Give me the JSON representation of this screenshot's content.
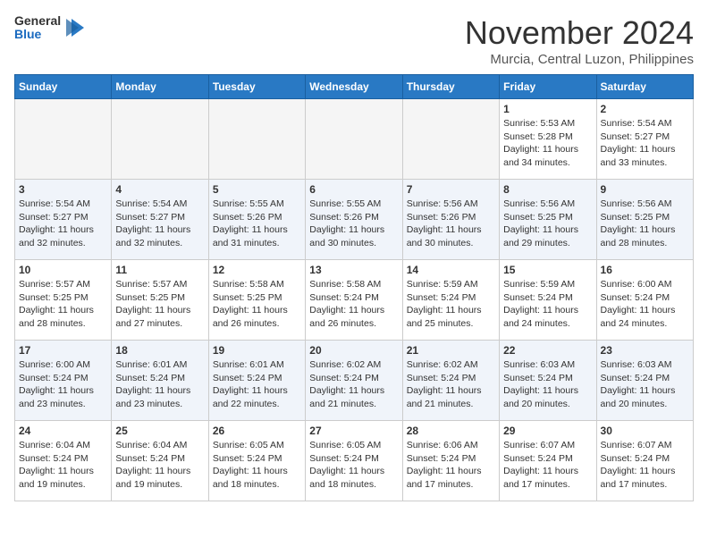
{
  "logo": {
    "general": "General",
    "blue": "Blue"
  },
  "title": "November 2024",
  "location": "Murcia, Central Luzon, Philippines",
  "days_header": [
    "Sunday",
    "Monday",
    "Tuesday",
    "Wednesday",
    "Thursday",
    "Friday",
    "Saturday"
  ],
  "weeks": [
    [
      {
        "day": "",
        "info": ""
      },
      {
        "day": "",
        "info": ""
      },
      {
        "day": "",
        "info": ""
      },
      {
        "day": "",
        "info": ""
      },
      {
        "day": "",
        "info": ""
      },
      {
        "day": "1",
        "info": "Sunrise: 5:53 AM\nSunset: 5:28 PM\nDaylight: 11 hours\nand 34 minutes."
      },
      {
        "day": "2",
        "info": "Sunrise: 5:54 AM\nSunset: 5:27 PM\nDaylight: 11 hours\nand 33 minutes."
      }
    ],
    [
      {
        "day": "3",
        "info": "Sunrise: 5:54 AM\nSunset: 5:27 PM\nDaylight: 11 hours\nand 32 minutes."
      },
      {
        "day": "4",
        "info": "Sunrise: 5:54 AM\nSunset: 5:27 PM\nDaylight: 11 hours\nand 32 minutes."
      },
      {
        "day": "5",
        "info": "Sunrise: 5:55 AM\nSunset: 5:26 PM\nDaylight: 11 hours\nand 31 minutes."
      },
      {
        "day": "6",
        "info": "Sunrise: 5:55 AM\nSunset: 5:26 PM\nDaylight: 11 hours\nand 30 minutes."
      },
      {
        "day": "7",
        "info": "Sunrise: 5:56 AM\nSunset: 5:26 PM\nDaylight: 11 hours\nand 30 minutes."
      },
      {
        "day": "8",
        "info": "Sunrise: 5:56 AM\nSunset: 5:25 PM\nDaylight: 11 hours\nand 29 minutes."
      },
      {
        "day": "9",
        "info": "Sunrise: 5:56 AM\nSunset: 5:25 PM\nDaylight: 11 hours\nand 28 minutes."
      }
    ],
    [
      {
        "day": "10",
        "info": "Sunrise: 5:57 AM\nSunset: 5:25 PM\nDaylight: 11 hours\nand 28 minutes."
      },
      {
        "day": "11",
        "info": "Sunrise: 5:57 AM\nSunset: 5:25 PM\nDaylight: 11 hours\nand 27 minutes."
      },
      {
        "day": "12",
        "info": "Sunrise: 5:58 AM\nSunset: 5:25 PM\nDaylight: 11 hours\nand 26 minutes."
      },
      {
        "day": "13",
        "info": "Sunrise: 5:58 AM\nSunset: 5:24 PM\nDaylight: 11 hours\nand 26 minutes."
      },
      {
        "day": "14",
        "info": "Sunrise: 5:59 AM\nSunset: 5:24 PM\nDaylight: 11 hours\nand 25 minutes."
      },
      {
        "day": "15",
        "info": "Sunrise: 5:59 AM\nSunset: 5:24 PM\nDaylight: 11 hours\nand 24 minutes."
      },
      {
        "day": "16",
        "info": "Sunrise: 6:00 AM\nSunset: 5:24 PM\nDaylight: 11 hours\nand 24 minutes."
      }
    ],
    [
      {
        "day": "17",
        "info": "Sunrise: 6:00 AM\nSunset: 5:24 PM\nDaylight: 11 hours\nand 23 minutes."
      },
      {
        "day": "18",
        "info": "Sunrise: 6:01 AM\nSunset: 5:24 PM\nDaylight: 11 hours\nand 23 minutes."
      },
      {
        "day": "19",
        "info": "Sunrise: 6:01 AM\nSunset: 5:24 PM\nDaylight: 11 hours\nand 22 minutes."
      },
      {
        "day": "20",
        "info": "Sunrise: 6:02 AM\nSunset: 5:24 PM\nDaylight: 11 hours\nand 21 minutes."
      },
      {
        "day": "21",
        "info": "Sunrise: 6:02 AM\nSunset: 5:24 PM\nDaylight: 11 hours\nand 21 minutes."
      },
      {
        "day": "22",
        "info": "Sunrise: 6:03 AM\nSunset: 5:24 PM\nDaylight: 11 hours\nand 20 minutes."
      },
      {
        "day": "23",
        "info": "Sunrise: 6:03 AM\nSunset: 5:24 PM\nDaylight: 11 hours\nand 20 minutes."
      }
    ],
    [
      {
        "day": "24",
        "info": "Sunrise: 6:04 AM\nSunset: 5:24 PM\nDaylight: 11 hours\nand 19 minutes."
      },
      {
        "day": "25",
        "info": "Sunrise: 6:04 AM\nSunset: 5:24 PM\nDaylight: 11 hours\nand 19 minutes."
      },
      {
        "day": "26",
        "info": "Sunrise: 6:05 AM\nSunset: 5:24 PM\nDaylight: 11 hours\nand 18 minutes."
      },
      {
        "day": "27",
        "info": "Sunrise: 6:05 AM\nSunset: 5:24 PM\nDaylight: 11 hours\nand 18 minutes."
      },
      {
        "day": "28",
        "info": "Sunrise: 6:06 AM\nSunset: 5:24 PM\nDaylight: 11 hours\nand 17 minutes."
      },
      {
        "day": "29",
        "info": "Sunrise: 6:07 AM\nSunset: 5:24 PM\nDaylight: 11 hours\nand 17 minutes."
      },
      {
        "day": "30",
        "info": "Sunrise: 6:07 AM\nSunset: 5:24 PM\nDaylight: 11 hours\nand 17 minutes."
      }
    ]
  ]
}
